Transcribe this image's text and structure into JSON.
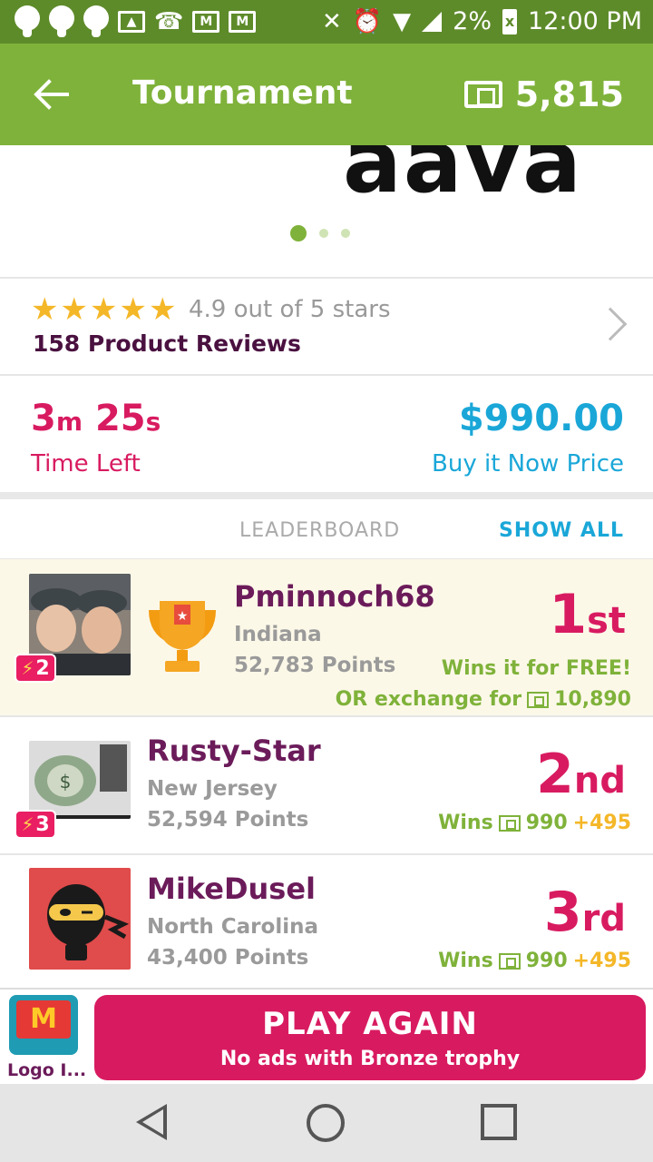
{
  "status_bar": {
    "battery_percent": "2%",
    "battery_icon_text": "x",
    "time": "12:00 PM",
    "icons": [
      "bulb-icon",
      "bulb-icon",
      "bulb-icon",
      "image-icon",
      "phone-icon",
      "gmail-icon",
      "gmail-icon",
      "mute-icon",
      "alarm-icon",
      "wifi-icon",
      "signal-icon",
      "battery-icon"
    ]
  },
  "app_bar": {
    "title": "Tournament",
    "ticket_count": "5,815"
  },
  "hero": {
    "brand_text": "aava",
    "carousel_pages": 3,
    "active_page": 1
  },
  "reviews": {
    "stars": 5,
    "rating_text": "4.9 out of 5 stars",
    "count_text": "158 Product Reviews"
  },
  "auction": {
    "time_minutes": "3",
    "time_minutes_unit": "m",
    "time_seconds": "25",
    "time_seconds_unit": "s",
    "time_label": "Time Left",
    "price": "$990.00",
    "price_label": "Buy it Now Price"
  },
  "leaderboard": {
    "title": "LEADERBOARD",
    "show_all": "SHOW ALL",
    "entries": [
      {
        "name": "Pminnoch68",
        "state": "Indiana",
        "points": "52,783 Points",
        "badge": "2",
        "place_num": "1",
        "place_suffix": "st",
        "win_text": "Wins it for FREE!",
        "exchange_text": "OR exchange for",
        "exchange_amount": "10,890"
      },
      {
        "name": "Rusty-Star",
        "state": "New Jersey",
        "points": "52,594 Points",
        "badge": "3",
        "place_num": "2",
        "place_suffix": "nd",
        "wins_label": "Wins",
        "wins_amount": "990",
        "wins_bonus": "+495"
      },
      {
        "name": "MikeDusel",
        "state": "North Carolina",
        "points": "43,400 Points",
        "place_num": "3",
        "place_suffix": "rd",
        "wins_label": "Wins",
        "wins_amount": "990",
        "wins_bonus": "+495"
      }
    ]
  },
  "banner": {
    "app_label": "Logo I...",
    "play_main": "PLAY AGAIN",
    "play_sub": "No ads with Bronze trophy"
  },
  "colors": {
    "app_bar": "#7fb23a",
    "status_bar": "#5e8b2a",
    "accent_pink": "#d81b60",
    "accent_blue": "#1aa7d8",
    "username": "#6b1b5a",
    "star": "#f4b728",
    "first_place_bg": "#fcf8e8"
  }
}
